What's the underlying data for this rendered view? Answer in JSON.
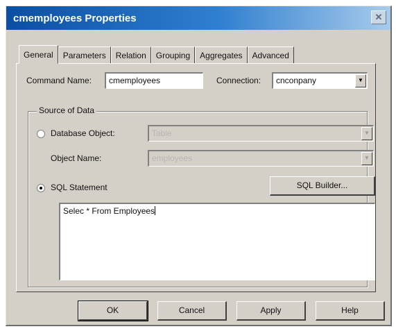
{
  "window": {
    "title": "cmemployees Properties",
    "close_icon": "close-icon"
  },
  "tabs": [
    {
      "label": "General",
      "active": true
    },
    {
      "label": "Parameters",
      "active": false
    },
    {
      "label": "Relation",
      "active": false
    },
    {
      "label": "Grouping",
      "active": false
    },
    {
      "label": "Aggregates",
      "active": false
    },
    {
      "label": "Advanced",
      "active": false
    }
  ],
  "general": {
    "command_name_label": "Command Name:",
    "command_name_value": "cmemployees",
    "connection_label": "Connection:",
    "connection_value": "cnconpany",
    "source_group_label": "Source of Data",
    "database_object_label": "Database Object:",
    "database_object_value": "Table",
    "object_name_label": "Object Name:",
    "object_name_value": "employees",
    "sql_statement_label": "SQL Statement",
    "sql_builder_label": "SQL Builder...",
    "sql_text": "Selec * From Employees",
    "selected_source": "SQL Statement"
  },
  "buttons": {
    "ok": "OK",
    "cancel": "Cancel",
    "apply": "Apply",
    "help": "Help"
  }
}
